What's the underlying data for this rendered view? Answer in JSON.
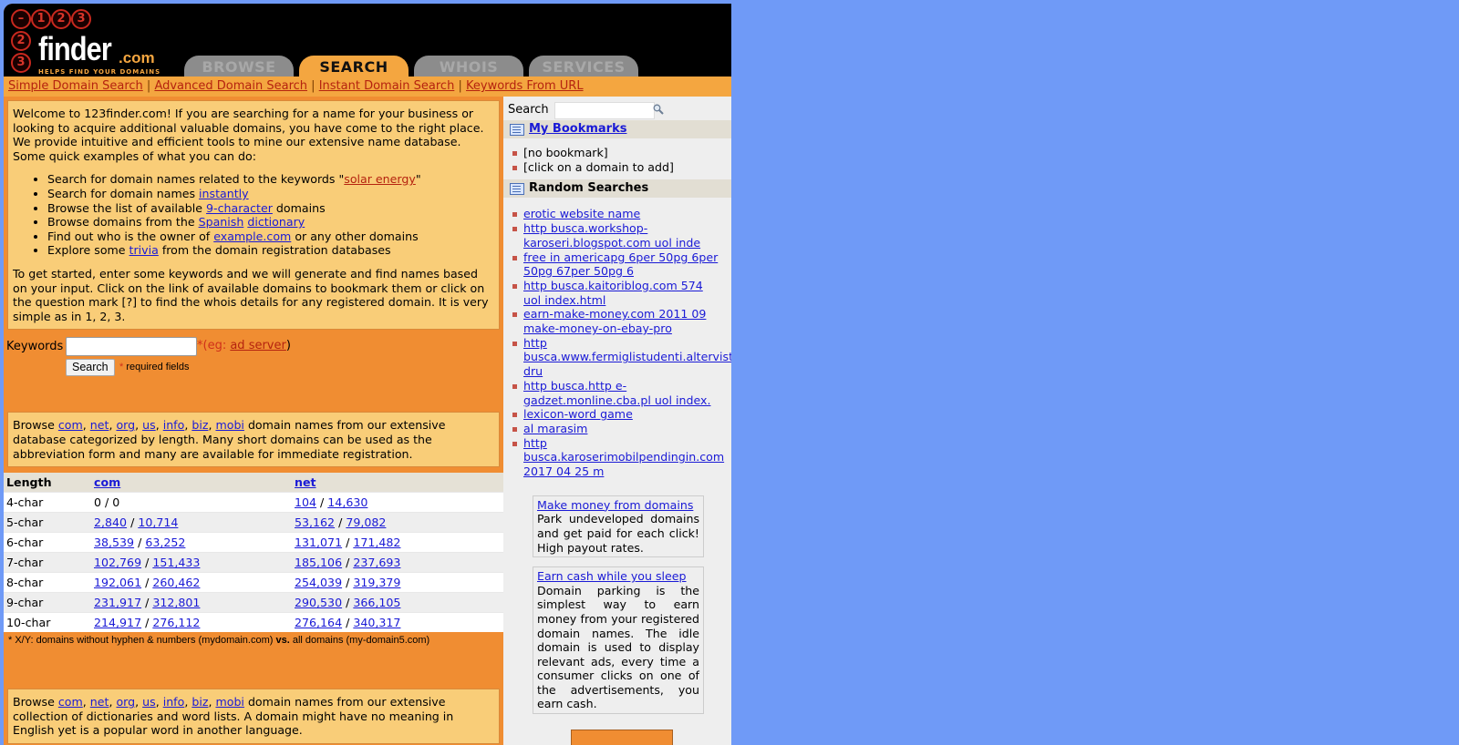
{
  "logo": {
    "digits": [
      "1",
      "2",
      "3"
    ],
    "side_digits": [
      "2",
      "3"
    ],
    "word": "finder",
    "tld": ".com",
    "tagline": "HELPS FIND YOUR DOMAINS"
  },
  "tabs": [
    {
      "label": "BROWSE",
      "active": false
    },
    {
      "label": "SEARCH",
      "active": true
    },
    {
      "label": "WHOIS",
      "active": false
    },
    {
      "label": "SERVICES",
      "active": false
    }
  ],
  "subnav": {
    "links": [
      "Simple Domain Search",
      "Advanced Domain Search",
      "Instant Domain Search",
      "Keywords From URL"
    ],
    "separator": "|"
  },
  "welcome": {
    "intro": "Welcome to 123finder.com! If you are searching for a name for your business or looking to acquire additional valuable domains, you have come to the right place. We provide intuitive and efficient tools to mine our extensive name database. Some quick examples of what you can do:",
    "bullets": [
      {
        "pre": "Search for domain names related to the keywords \"",
        "link": "solar energy",
        "post": "\""
      },
      {
        "pre": "Search for domain names ",
        "link": "instantly",
        "post": ""
      },
      {
        "pre": "Browse the list of available ",
        "link": "9-character",
        "post": " domains"
      },
      {
        "pre": "Browse domains from the ",
        "link": "Spanish",
        "mid": " ",
        "link2": "dictionary",
        "post": ""
      },
      {
        "pre": "Find out who is the owner of ",
        "link": "example.com",
        "post": " or any other domains"
      },
      {
        "pre": "Explore some ",
        "link": "trivia",
        "post": " from the domain registration databases"
      }
    ],
    "outro": "To get started, enter some keywords and we will generate and find names based on your input. Click on the link of available domains to bookmark them or click on the question mark [?] to find the whois details for any registered domain. It is very simple as in 1, 2, 3."
  },
  "keyword_form": {
    "label": "Keywords",
    "value": "",
    "hint_pre": "*(eg: ",
    "hint_link": "ad server",
    "hint_post": ")",
    "button": "Search",
    "required_star": "*",
    "required_text": "required fields"
  },
  "browse_length": {
    "pre": "Browse ",
    "tlds": [
      "com",
      "net",
      "org",
      "us",
      "info",
      "biz",
      "mobi"
    ],
    "post": " domain names from our extensive database categorized by length. Many short domains can be used as the abbreviation form and many are available for immediate registration."
  },
  "length_table": {
    "headers": [
      "Length",
      "com",
      "net"
    ],
    "rows": [
      {
        "length": "4-char",
        "com": [
          "0",
          "0"
        ],
        "com_linked": false,
        "net": [
          "104",
          "14,630"
        ]
      },
      {
        "length": "5-char",
        "com": [
          "2,840",
          "10,714"
        ],
        "com_linked": true,
        "net": [
          "53,162",
          "79,082"
        ]
      },
      {
        "length": "6-char",
        "com": [
          "38,539",
          "63,252"
        ],
        "com_linked": true,
        "net": [
          "131,071",
          "171,482"
        ]
      },
      {
        "length": "7-char",
        "com": [
          "102,769",
          "151,433"
        ],
        "com_linked": true,
        "net": [
          "185,106",
          "237,693"
        ]
      },
      {
        "length": "8-char",
        "com": [
          "192,061",
          "260,462"
        ],
        "com_linked": true,
        "net": [
          "254,039",
          "319,379"
        ]
      },
      {
        "length": "9-char",
        "com": [
          "231,917",
          "312,801"
        ],
        "com_linked": true,
        "net": [
          "290,530",
          "366,105"
        ]
      },
      {
        "length": "10-char",
        "com": [
          "214,917",
          "276,112"
        ],
        "com_linked": true,
        "net": [
          "276,164",
          "340,317"
        ]
      }
    ],
    "footnote_pre": "* X/Y: domains without hyphen & numbers (mydomain.com) ",
    "footnote_bold": "vs.",
    "footnote_post": " all domains (my-domain5.com)"
  },
  "browse_dict": {
    "pre": "Browse ",
    "tlds": [
      "com",
      "net",
      "org",
      "us",
      "info",
      "biz",
      "mobi"
    ],
    "post": " domain names from our extensive collection of dictionaries and word lists. A domain might have no meaning in English yet is a popular word in another language."
  },
  "sidebar": {
    "search_label": "Search",
    "search_value": "",
    "bookmarks_title": "My Bookmarks",
    "bookmarks": [
      "[no bookmark]",
      "[click on a domain to add]"
    ],
    "random_title": "Random Searches",
    "random": [
      "erotic website name",
      "http busca.workshop-karoseri.blogspot.com uol inde",
      "free in americapg 6per 50pg 6per 50pg 67per 50pg 6",
      "http busca.kaitoriblog.com 574 uol index.html",
      "earn-make-money.com 2011 09 make-money-on-ebay-pro",
      "http busca.www.fermiglistudenti.altervista.org dru",
      "http busca.http e-gadzet.monline.cba.pl uol index.",
      "lexicon-word game",
      "al marasim",
      "http busca.karoserimobilpendingin.com 2017 04 25 m"
    ],
    "ads": [
      {
        "title": "Make money from domains",
        "body": "Park undeveloped domains and get paid for each click! High payout rates."
      },
      {
        "title": "Earn cash while you sleep",
        "body": "Domain parking is the simplest way to earn money from your registered domain names. The idle domain is used to display relevant ads, every time a consumer clicks on one of the advertisements, you earn cash."
      }
    ]
  },
  "colors": {
    "page_bg": "#6f9af7",
    "header_bg": "#000000",
    "orange": "#f08d32",
    "light_orange": "#f4a640",
    "box_bg": "#f9cd78",
    "link": "#1a1ad6",
    "link_red": "#b5230f"
  }
}
